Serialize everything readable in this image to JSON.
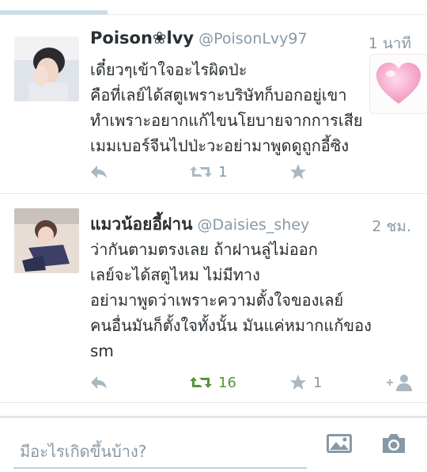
{
  "tweets": [
    {
      "name": "Poison❀lvy",
      "handle": "@PoisonLvy97",
      "time": "1 นาที",
      "text": "เดี๋ยวๆเข้าใจอะไรผิดป่ะ\nคือที่เลย์ได้สตูเพราะบริษัทก็บอกอยู่เขา\nทำเพราะอยากแก้ไขนโยบายจากการเสีย\nเมมเบอร์จีนไปป่ะวะอย่ามาพูดดูถูกอี้ซิง",
      "retweet_count": "1",
      "favorite_count": ""
    },
    {
      "name": "แมวน้อยอี้ฝาน",
      "handle": "@Daisies_shey",
      "time": "2 ชม.",
      "text": "ว่ากันตามตรงเลย ถ้าฝานลู่ไม่ออก\nเลย์จะได้สตูไหม ไม่มีทาง\nอย่ามาพูดว่าเพราะความตั้งใจของเลย์\nคนอื่นมันก็ตั้งใจทั้งนั้น มันแค่หมากแก้ของ\nsm",
      "retweet_count": "16",
      "favorite_count": "1"
    }
  ],
  "compose": {
    "placeholder": "มีอะไรเกิดขึ้นบ้าง?"
  },
  "colors": {
    "icon_gray": "#aab8c2",
    "retweet_green": "#5c913b",
    "handle_gray": "#8899a6"
  }
}
